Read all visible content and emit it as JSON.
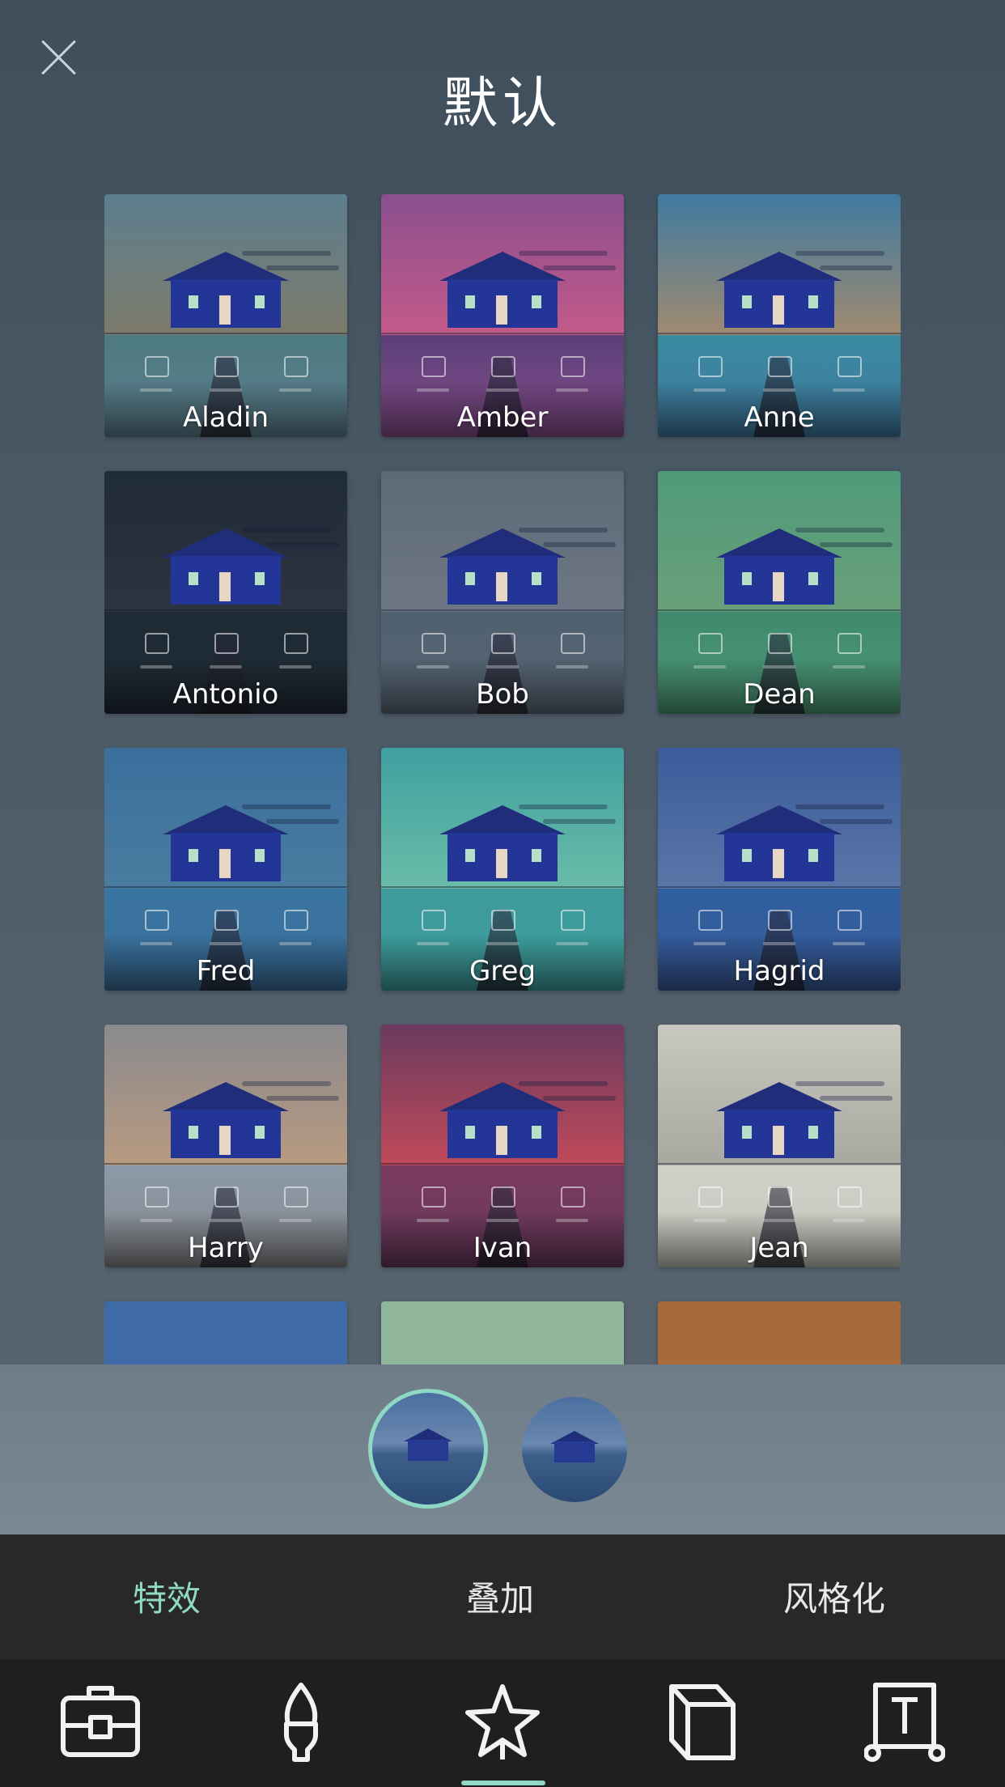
{
  "header": {
    "title": "默认"
  },
  "filters": [
    {
      "label": "Aladin",
      "sky": "#5d7f8f",
      "water": "#4d7a80",
      "mid": "#7c7a6a"
    },
    {
      "label": "Amber",
      "sky": "#8a4f8e",
      "water": "#5a3f78",
      "mid": "#c45a8a"
    },
    {
      "label": "Anne",
      "sky": "#3f7aa0",
      "water": "#3a8aa0",
      "mid": "#a08a70"
    },
    {
      "label": "Antonio",
      "sky": "#1f2b36",
      "water": "#1e2b34",
      "mid": "#2c3440"
    },
    {
      "label": "Bob",
      "sky": "#5c6a78",
      "water": "#4e5f6e",
      "mid": "#6e7684"
    },
    {
      "label": "Dean",
      "sky": "#4f9a7a",
      "water": "#3f8a6e",
      "mid": "#6aa07a"
    },
    {
      "label": "Fred",
      "sky": "#3b6f9c",
      "water": "#3a75a0",
      "mid": "#4a7ca0"
    },
    {
      "label": "Greg",
      "sky": "#3fa0a0",
      "water": "#3f9a9a",
      "mid": "#6abca8"
    },
    {
      "label": "Hagrid",
      "sky": "#3a5c9a",
      "water": "#2f5fa0",
      "mid": "#5a76a8"
    },
    {
      "label": "Harry",
      "sky": "#8a8a8e",
      "water": "#8a9aa8",
      "mid": "#b89a80"
    },
    {
      "label": "Ivan",
      "sky": "#6a3a5e",
      "water": "#7a3a5e",
      "mid": "#c04a5a"
    },
    {
      "label": "Jean",
      "sky": "#c8c8c0",
      "water": "#d0d0c8",
      "mid": "#a8a8a0"
    },
    {
      "label": "",
      "sky": "#3e6ba8",
      "water": "#3e6ba8",
      "mid": "#3e6ba8"
    },
    {
      "label": "",
      "sky": "#8fb69a",
      "water": "#8fb69a",
      "mid": "#8fb69a"
    },
    {
      "label": "",
      "sky": "#a86a3a",
      "water": "#a86a3a",
      "mid": "#a86a3a"
    }
  ],
  "tabs": [
    {
      "label": "特效",
      "active": true
    },
    {
      "label": "叠加",
      "active": false
    },
    {
      "label": "风格化",
      "active": false
    }
  ],
  "toolbar": {
    "tools": [
      "briefcase-icon",
      "brush-icon",
      "effects-star-icon",
      "crop-frame-icon",
      "text-icon"
    ],
    "active_index": 2
  },
  "colors": {
    "accent": "#8fd8c4",
    "tab_text": "#e8e8e8"
  }
}
